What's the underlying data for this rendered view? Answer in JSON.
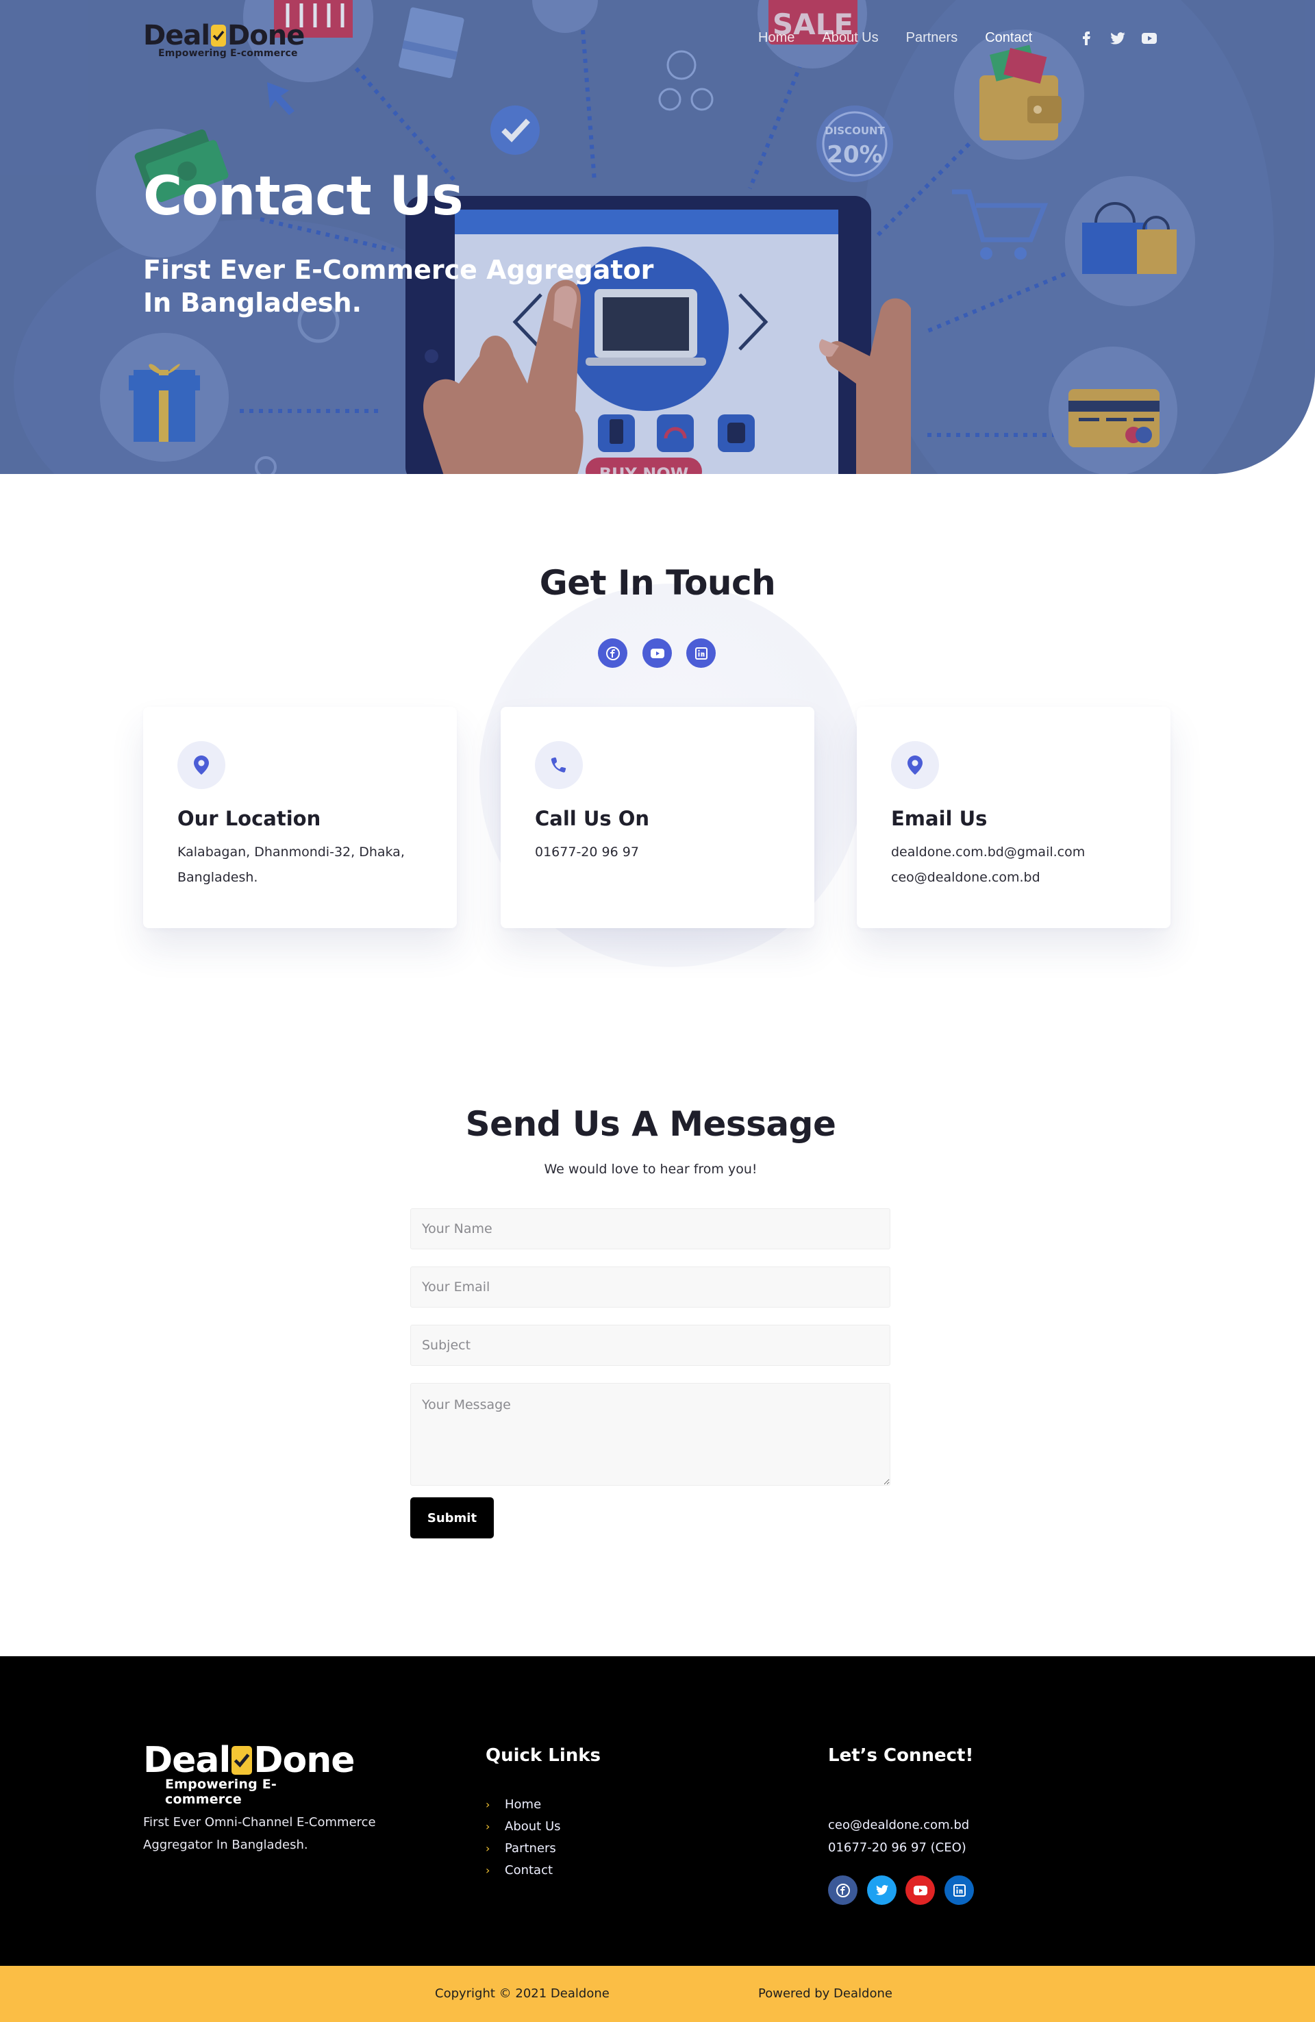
{
  "brand": {
    "name_left": "Deal",
    "name_right": "Done",
    "tagline": "Empowering E-commerce",
    "accent": "#f4c534"
  },
  "nav": {
    "items": [
      "Home",
      "About Us",
      "Partners",
      "Contact"
    ],
    "active": "Contact"
  },
  "hero": {
    "title": "Contact Us",
    "subtitle": "First Ever E-Commerce Aggregator In Bangladesh.",
    "art_labels": {
      "sale": "SALE",
      "discount": "DISCOUNT",
      "discount_value": "20%",
      "buy_now": "BUY NOW"
    },
    "social_icons": [
      "facebook-icon",
      "twitter-icon",
      "youtube-icon"
    ]
  },
  "touch": {
    "title": "Get In Touch",
    "social_icons": [
      "facebook-icon",
      "youtube-icon",
      "linkedin-icon"
    ],
    "cards": [
      {
        "icon": "location-pin-icon",
        "title": "Our Location",
        "lines": [
          "Kalabagan, Dhanmondi-32, Dhaka,",
          "Bangladesh."
        ]
      },
      {
        "icon": "phone-icon",
        "title": "Call Us On",
        "lines": [
          "01677-20 96 97"
        ]
      },
      {
        "icon": "location-pin-icon",
        "title": "Email Us",
        "lines": [
          "dealdone.com.bd@gmail.com",
          "ceo@dealdone.com.bd"
        ]
      }
    ]
  },
  "message": {
    "title": "Send Us A Message",
    "lead": "We would love to hear from you!",
    "fields": {
      "name_placeholder": "Your Name",
      "email_placeholder": "Your Email",
      "subject_placeholder": "Subject",
      "message_placeholder": "Your Message"
    },
    "submit_label": "Submit"
  },
  "footer": {
    "description": "First Ever Omni-Channel E-Commerce Aggregator In Bangladesh.",
    "quick_links_title": "Quick Links",
    "quick_links": [
      "Home",
      "About Us",
      "Partners",
      "Contact"
    ],
    "connect_title": "Let’s Connect!",
    "email": "ceo@dealdone.com.bd",
    "phone": "01677-20 96 97 (CEO)",
    "social": [
      {
        "icon": "facebook-icon",
        "color": "#3b5998"
      },
      {
        "icon": "twitter-icon",
        "color": "#1da1f2"
      },
      {
        "icon": "youtube-icon",
        "color": "#e02424"
      },
      {
        "icon": "linkedin-icon",
        "color": "#0a66c2"
      }
    ],
    "copyright": "Copyright © 2021 Dealdone",
    "powered": "Powered by Dealdone",
    "bar_color": "#fbbe45"
  }
}
